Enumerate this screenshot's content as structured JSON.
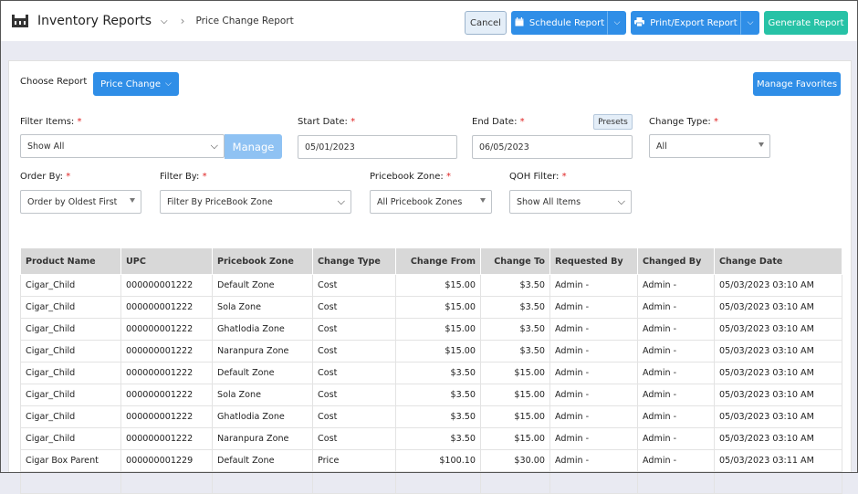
{
  "header": {
    "app_icon": "store-icon",
    "title": "Inventory Reports",
    "breadcrumb": "Price Change Report",
    "cancel_label": "Cancel",
    "schedule_label": "Schedule Report",
    "print_label": "Print/Export Report",
    "generate_label": "Generate Report"
  },
  "report": {
    "choose_label": "Choose Report",
    "selected": "Price Change",
    "manage_favorites_label": "Manage Favorites"
  },
  "filters": {
    "filter_items": {
      "label": "Filter Items:",
      "value": "Show All",
      "manage_label": "Manage"
    },
    "start_date": {
      "label": "Start Date:",
      "value": "05/01/2023"
    },
    "end_date": {
      "label": "End Date:",
      "value": "06/05/2023",
      "presets_label": "Presets"
    },
    "change_type": {
      "label": "Change Type:",
      "value": "All"
    },
    "order_by": {
      "label": "Order By:",
      "value": "Order by Oldest First"
    },
    "filter_by": {
      "label": "Filter By:",
      "value": "Filter By PriceBook Zone"
    },
    "pricebook_zone": {
      "label": "Pricebook Zone:",
      "value": "All Pricebook Zones"
    },
    "qoh_filter": {
      "label": "QOH Filter:",
      "value": "Show All Items"
    },
    "required_mark": "*"
  },
  "table": {
    "columns": [
      "Product Name",
      "UPC",
      "Pricebook Zone",
      "Change Type",
      "Change From",
      "Change To",
      "Requested By",
      "Changed By",
      "Change Date"
    ],
    "rows": [
      [
        "Cigar_Child",
        "000000001222",
        "Default Zone",
        "Cost",
        "$15.00",
        "$3.50",
        "Admin -",
        "Admin -",
        "05/03/2023 03:10 AM"
      ],
      [
        "Cigar_Child",
        "000000001222",
        "Sola Zone",
        "Cost",
        "$15.00",
        "$3.50",
        "Admin -",
        "Admin -",
        "05/03/2023 03:10 AM"
      ],
      [
        "Cigar_Child",
        "000000001222",
        "Ghatlodia Zone",
        "Cost",
        "$15.00",
        "$3.50",
        "Admin -",
        "Admin -",
        "05/03/2023 03:10 AM"
      ],
      [
        "Cigar_Child",
        "000000001222",
        "Naranpura Zone",
        "Cost",
        "$15.00",
        "$3.50",
        "Admin -",
        "Admin -",
        "05/03/2023 03:10 AM"
      ],
      [
        "Cigar_Child",
        "000000001222",
        "Default Zone",
        "Cost",
        "$3.50",
        "$15.00",
        "Admin -",
        "Admin -",
        "05/03/2023 03:10 AM"
      ],
      [
        "Cigar_Child",
        "000000001222",
        "Sola Zone",
        "Cost",
        "$3.50",
        "$15.00",
        "Admin -",
        "Admin -",
        "05/03/2023 03:10 AM"
      ],
      [
        "Cigar_Child",
        "000000001222",
        "Ghatlodia Zone",
        "Cost",
        "$3.50",
        "$15.00",
        "Admin -",
        "Admin -",
        "05/03/2023 03:10 AM"
      ],
      [
        "Cigar_Child",
        "000000001222",
        "Naranpura Zone",
        "Cost",
        "$3.50",
        "$15.00",
        "Admin -",
        "Admin -",
        "05/03/2023 03:10 AM"
      ],
      [
        "Cigar Box Parent",
        "000000001229",
        "Default Zone",
        "Price",
        "$100.10",
        "$30.00",
        "Admin -",
        "Admin -",
        "05/03/2023 03:11 AM"
      ],
      [
        "",
        "",
        "",
        "",
        "",
        "",
        "",
        "",
        ""
      ]
    ]
  }
}
